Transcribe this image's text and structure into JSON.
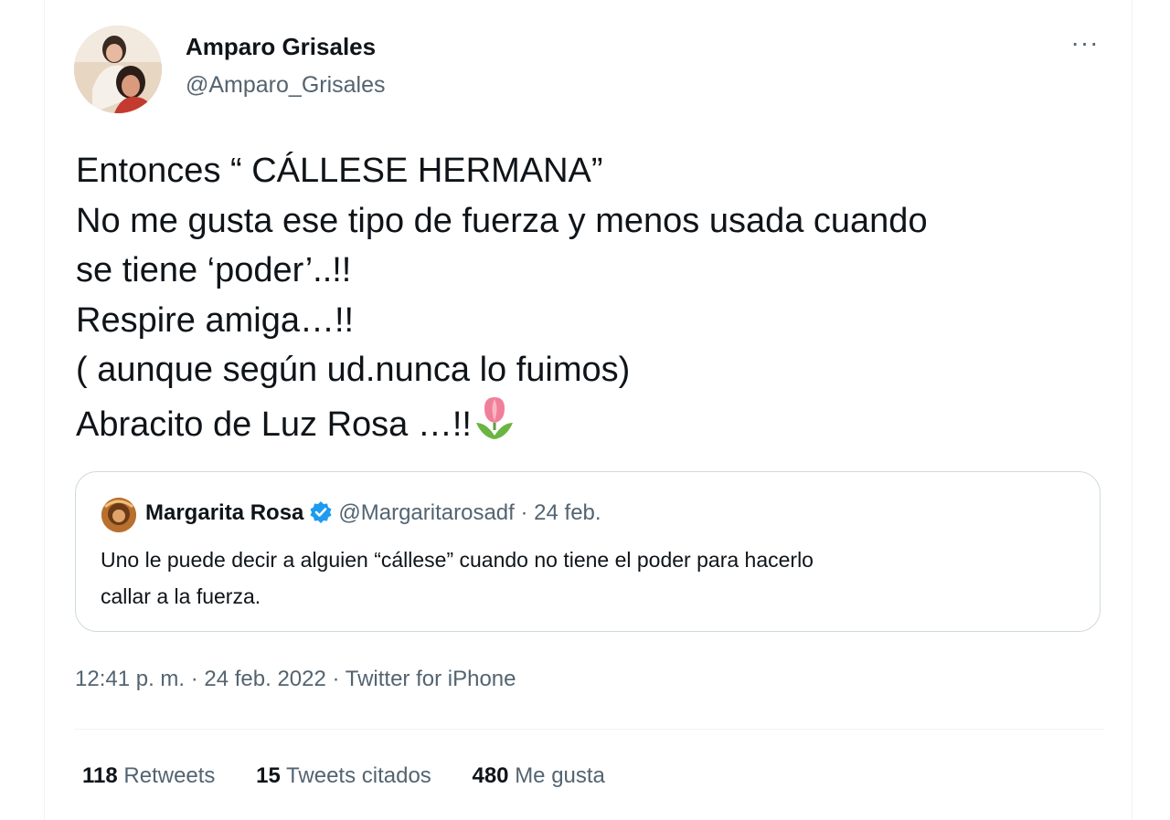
{
  "author": {
    "name": "Amparo Grisales",
    "handle": "@Amparo_Grisales"
  },
  "more_label": "···",
  "tweet_lines": [
    "Entonces “  CÁLLESE HERMANA”",
    "No me gusta ese tipo de fuerza y menos usada cuando",
    "se tiene ‘poder’..!!",
    "Respire amiga…!!",
    "( aunque según ud.nunca  lo fuimos)",
    "Abracito de Luz  Rosa …!!"
  ],
  "emoji": "tulip-icon",
  "quoted": {
    "name": "Margarita Rosa",
    "handle": "@Margaritarosadf",
    "separator": "·",
    "date": "24 feb.",
    "text_line1": "Uno le puede decir a alguien “cállese” cuando no tiene el poder para hacerlo",
    "text_line2": "callar a la fuerza."
  },
  "timestamp": "12:41 p. m. · 24 feb. 2022 · Twitter for iPhone",
  "stats": {
    "retweets_count": "118",
    "retweets_label": "Retweets",
    "quotes_count": "15",
    "quotes_label": "Tweets citados",
    "likes_count": "480",
    "likes_label": "Me gusta"
  },
  "colors": {
    "text": "#0f1419",
    "secondary": "#536471",
    "border": "#cfd9de",
    "verified": "#1d9bf0"
  }
}
